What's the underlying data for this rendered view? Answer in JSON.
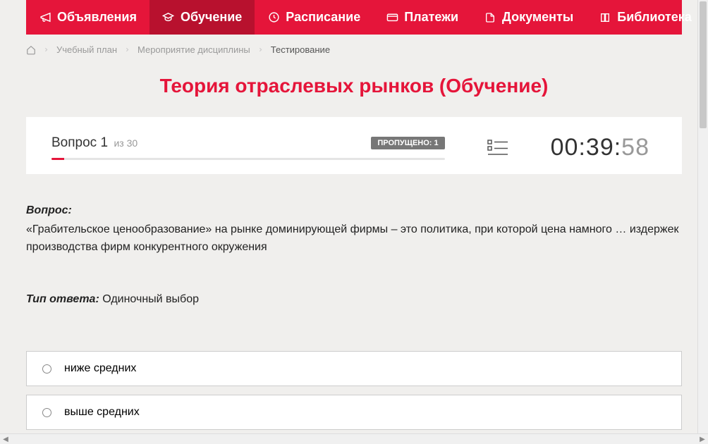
{
  "nav": {
    "items": [
      {
        "label": "Объявления",
        "icon": "megaphone"
      },
      {
        "label": "Обучение",
        "icon": "grad-cap",
        "active": true
      },
      {
        "label": "Расписание",
        "icon": "clock"
      },
      {
        "label": "Платежи",
        "icon": "card"
      },
      {
        "label": "Документы",
        "icon": "doc"
      },
      {
        "label": "Библиотека",
        "icon": "book",
        "dropdown": true
      }
    ]
  },
  "breadcrumb": {
    "items": [
      "Учебный план",
      "Мероприятие дисциплины"
    ],
    "current": "Тестирование"
  },
  "page_title": "Теория отраслевых рынков (Обучение)",
  "quiz": {
    "question_label": "Вопрос 1",
    "total_label": "из 30",
    "skipped_badge": "ПРОПУЩЕНО: 1",
    "timer_main": "00:39:",
    "timer_sec": "58",
    "question_heading": "Вопрос:",
    "question_text": "«Грабительское ценообразование» на рынке доминирующей фирмы – это политика, при которой цена намного … издержек производства фирм конкурентного окружения",
    "answer_type_label": "Тип ответа:",
    "answer_type_value": " Одиночный выбор",
    "options": [
      "ниже средних",
      "выше средних"
    ]
  }
}
